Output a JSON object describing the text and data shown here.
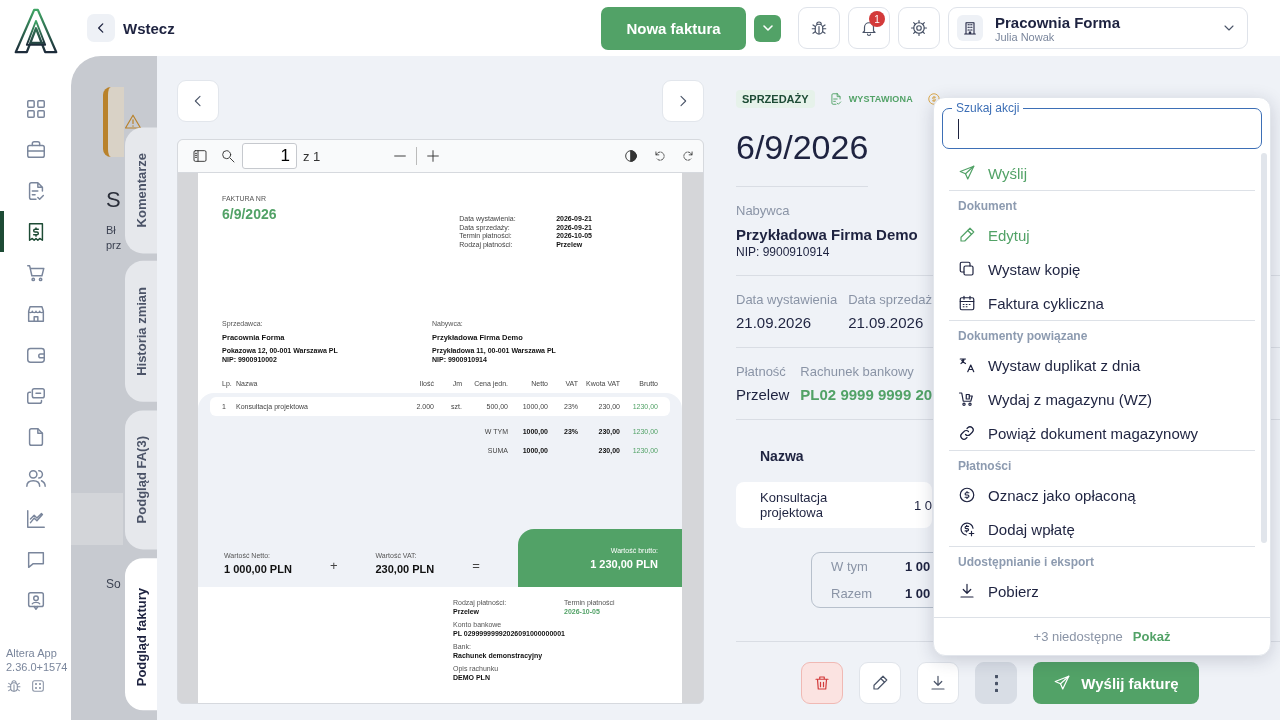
{
  "app": {
    "name": "Altera App",
    "version": "2.36.0+1574"
  },
  "sidebar": {
    "items": [
      {
        "selected": false
      },
      {
        "selected": false
      },
      {
        "selected": false
      },
      {
        "selected": true
      },
      {
        "selected": false
      },
      {
        "selected": false
      },
      {
        "selected": false
      },
      {
        "selected": false
      },
      {
        "selected": false
      },
      {
        "selected": false
      },
      {
        "selected": false
      },
      {
        "selected": false
      },
      {
        "selected": false
      }
    ]
  },
  "topbar": {
    "back": "Wstecz",
    "new_invoice": "Nowa faktura",
    "notifications": "1",
    "company": {
      "name": "Pracownia Forma",
      "user": "Julia Nowak"
    }
  },
  "background": {
    "heading": "S",
    "text": [
      "Bł",
      "prz"
    ],
    "label": "So"
  },
  "side_tabs": [
    {
      "label": "Komentarze",
      "selected": false
    },
    {
      "label": "Historia zmian",
      "selected": false
    },
    {
      "label": "Podgląd FA(3)",
      "selected": false
    },
    {
      "label": "Podgląd faktury",
      "selected": true
    }
  ],
  "viewer": {
    "page": "1",
    "page_count": "z 1"
  },
  "pdf": {
    "title_label": "FAKTURA NR",
    "number": "6/9/2026",
    "meta": [
      {
        "label": "Data wystawienia:",
        "value": "2026-09-21"
      },
      {
        "label": "Data sprzedaży:",
        "value": "2026-09-21"
      },
      {
        "label": "Termin płatności:",
        "value": "2026-10-05"
      },
      {
        "label": "Rodzaj płatności:",
        "value": "Przelew"
      }
    ],
    "seller": {
      "label": "Sprzedawca:",
      "name": "Pracownia Forma",
      "address": "Pokazowa 12, 00-001 Warszawa PL",
      "nip": "NIP: 9900910002"
    },
    "buyer": {
      "label": "Nabywca:",
      "name": "Przykładowa Firma Demo",
      "address": "Przykładowa 11, 00-001 Warszawa PL",
      "nip": "NIP: 9900910914"
    },
    "columns": [
      "Lp.",
      "Nazwa",
      "Ilość",
      "Jm",
      "Cena jedn.",
      "Netto",
      "VAT",
      "Kwota VAT",
      "Brutto"
    ],
    "rows": [
      [
        "1",
        "Konsultacja projektowa",
        "2.000",
        "szt.",
        "500,00",
        "1000,00",
        "23%",
        "230,00",
        "1230,00"
      ]
    ],
    "summary": [
      {
        "label": "W TYM",
        "net": "1000,00",
        "vat": "23%",
        "vat_amount": "230,00",
        "gross": "1230,00"
      },
      {
        "label": "SUMA",
        "net": "1000,00",
        "vat_amount": "230,00",
        "gross": "1230,00"
      }
    ],
    "totals": {
      "net_label": "Wartość Netto:",
      "net": "1 000,00 PLN",
      "plus": "+",
      "vat_label": "Wartość VAT:",
      "vat": "230,00 PLN",
      "equals": "=",
      "gross_label": "Wartość brutto:",
      "gross": "1 230,00 PLN"
    },
    "payment": [
      {
        "label": "Rodzaj płatności:",
        "value": "Przelew",
        "accent": false
      },
      {
        "label": "Termin płatności",
        "value": "2026-10-05",
        "accent": true
      },
      {
        "label": "Konto bankowe",
        "value": "PL 02999999992026091000000001",
        "accent": false
      },
      {
        "label": "Bank:",
        "value": "Rachunek demonstracyjny",
        "accent": false
      },
      {
        "label": "Opis rachunku",
        "value": "DEMO PLN",
        "accent": false
      }
    ]
  },
  "details": {
    "badges": [
      {
        "kind": "type",
        "label": "SPRZEDAŻY"
      },
      {
        "kind": "status",
        "label": "WYSTAWIONA"
      },
      {
        "kind": "payment"
      }
    ],
    "number": "6/9/2026",
    "buyer_label": "Nabywca",
    "buyer": "Przykładowa Firma Demo",
    "buyer_nip": "NIP: 9900910914",
    "dates": [
      {
        "label": "Data wystawienia",
        "value": "21.09.2026",
        "accent": false
      },
      {
        "label": "Data sprzedaż",
        "value": "21.09.2026",
        "accent": false
      }
    ],
    "payment": [
      {
        "label": "Płatność",
        "value": "Przelew",
        "accent": false
      },
      {
        "label": "Rachunek bankowy",
        "value": "PL02 9999 9999 20",
        "accent": true
      }
    ],
    "table": {
      "columns": [
        "Nazwa"
      ],
      "rows": [
        [
          "Konsultacja projektowa",
          "1 0"
        ]
      ]
    },
    "summary": [
      {
        "label": "W tym",
        "value": "1 00"
      },
      {
        "label": "Razem",
        "value": "1 00"
      }
    ]
  },
  "actions": {
    "send": "Wyślij fakturę"
  },
  "menu": {
    "open": true,
    "search_label": "Szukaj akcji",
    "sections": [
      {
        "items": [
          {
            "label": "Wyślij",
            "accent": true
          }
        ]
      },
      {
        "title": "Dokument",
        "items": [
          {
            "label": "Edytuj",
            "accent": true
          },
          {
            "label": "Wystaw kopię",
            "accent": false
          },
          {
            "label": "Faktura cykliczna",
            "accent": false
          }
        ]
      },
      {
        "title": "Dokumenty powiązane",
        "items": [
          {
            "label": "Wystaw duplikat z dnia",
            "accent": false
          },
          {
            "label": "Wydaj z magazynu (WZ)",
            "accent": false
          },
          {
            "label": "Powiąż dokument magazynowy",
            "accent": false
          }
        ]
      },
      {
        "title": "Płatności",
        "items": [
          {
            "label": "Oznacz jako opłaconą",
            "accent": false
          },
          {
            "label": "Dodaj wpłatę",
            "accent": false
          }
        ]
      },
      {
        "title": "Udostępnianie i eksport",
        "items": [
          {
            "label": "Pobierz",
            "accent": false
          }
        ]
      }
    ],
    "footer": {
      "count": "+3 niedostępne",
      "link": "Pokaż"
    }
  }
}
